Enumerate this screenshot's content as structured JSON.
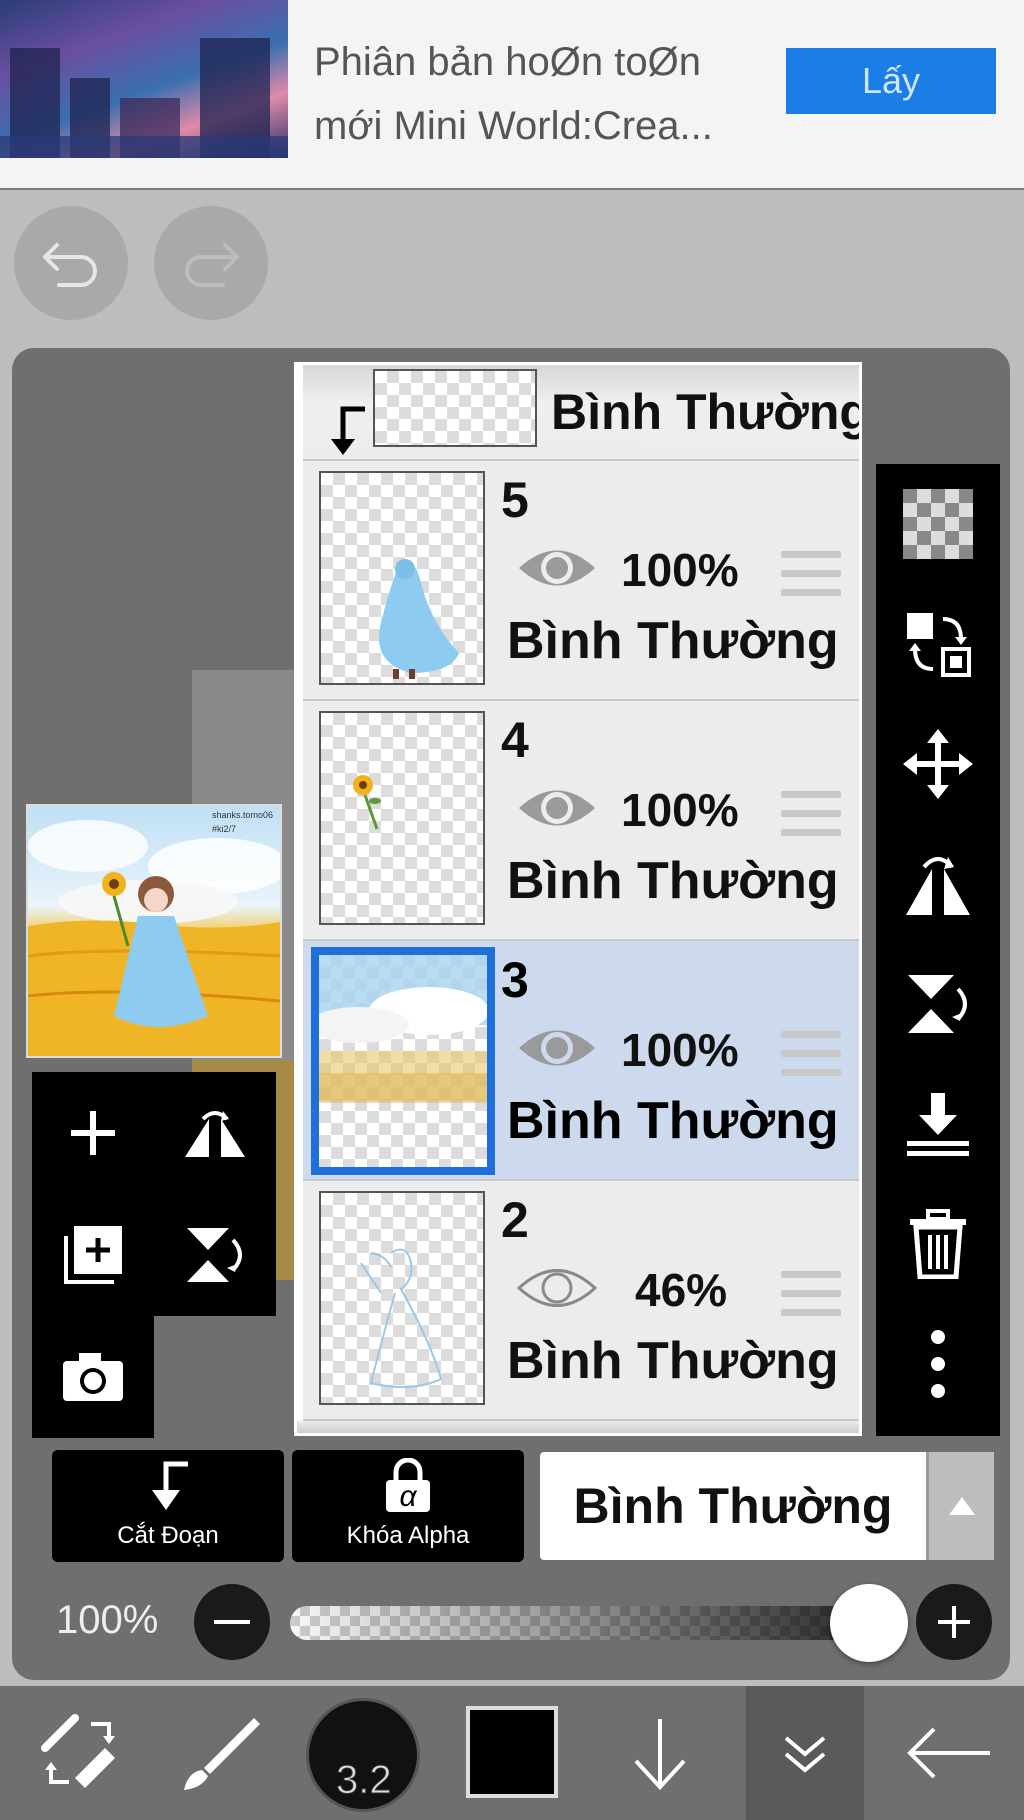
{
  "ad": {
    "text_line1": "Phiân bản hoØn toØn",
    "text_line2": "mới Mini World:Crea...",
    "button_label": "Lấy"
  },
  "layers": {
    "top": {
      "mode": "Bình Thường"
    },
    "items": [
      {
        "number": "5",
        "opacity": "100%",
        "mode": "Bình Thường",
        "visible": true,
        "selected": false
      },
      {
        "number": "4",
        "opacity": "100%",
        "mode": "Bình Thường",
        "visible": true,
        "selected": false
      },
      {
        "number": "3",
        "opacity": "100%",
        "mode": "Bình Thường",
        "visible": true,
        "selected": true
      },
      {
        "number": "2",
        "opacity": "46%",
        "mode": "Bình Thường",
        "visible": true,
        "selected": false
      }
    ]
  },
  "preview": {
    "watermark_line1": "shanks.tomo06",
    "watermark_line2": "#ki2/7"
  },
  "controls": {
    "clip_label": "Cắt Đoạn",
    "alpha_lock_label": "Khóa Alpha",
    "alpha_symbol": "α",
    "blend_mode": "Bình Thường",
    "opacity_label": "100%",
    "opacity_value": 1.0
  },
  "bottombar": {
    "brush_size": "3.2",
    "color": "#000000"
  },
  "colors": {
    "accent": "#1e6fd9",
    "ad_button": "#1a7ee6",
    "selected_layer": "#cdd9ec"
  }
}
